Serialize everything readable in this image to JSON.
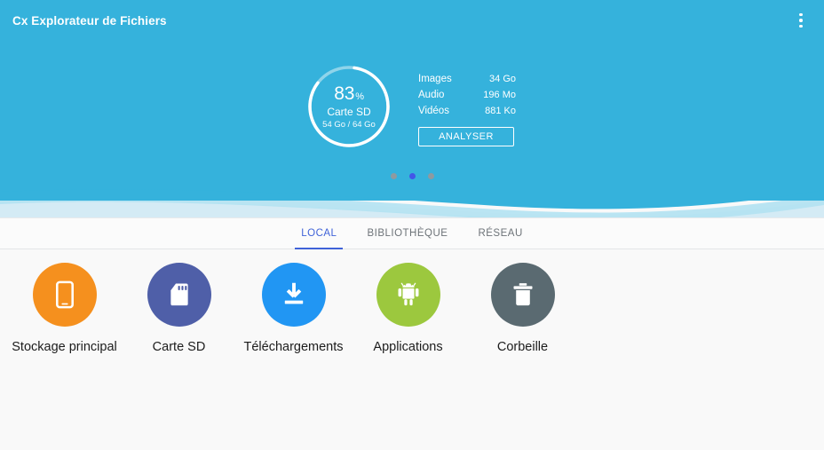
{
  "app": {
    "title": "Cx Explorateur de Fichiers",
    "header_color": "#35b2dc",
    "wave_light_color": "#b3e2f2",
    "wave_pale_color": "#eef4f6",
    "background": "#f9f9f9"
  },
  "appbar": {
    "overflow_icon": "more-vertical-icon"
  },
  "storage": {
    "percent": "83",
    "percent_symbol": "%",
    "label": "Carte SD",
    "detail": "54 Go / 64 Go",
    "used_gb": 54,
    "total_gb": 64,
    "percent_value": 83
  },
  "stats": {
    "rows": [
      {
        "label": "Images",
        "value": "34 Go"
      },
      {
        "label": "Audio",
        "value": "196 Mo"
      },
      {
        "label": "Vidéos",
        "value": "881 Ko"
      }
    ],
    "analyse_label": "ANALYSER"
  },
  "carousel": {
    "dots": [
      {
        "active": false
      },
      {
        "active": true
      },
      {
        "active": false
      }
    ],
    "active_color": "#4356e8",
    "inactive_color": "#8e9aa0"
  },
  "tabs": {
    "active_color": "#3f62d8",
    "items": [
      {
        "label": "LOCAL",
        "active": true
      },
      {
        "label": "BIBLIOTHÈQUE",
        "active": false
      },
      {
        "label": "RÉSEAU",
        "active": false
      }
    ]
  },
  "shortcuts": [
    {
      "label": "Stockage principal",
      "icon": "phone-icon",
      "color": "#f5901e"
    },
    {
      "label": "Carte SD",
      "icon": "sd-card-icon",
      "color": "#4f5fa8"
    },
    {
      "label": "Téléchargements",
      "icon": "download-icon",
      "color": "#2196f3"
    },
    {
      "label": "Applications",
      "icon": "android-icon",
      "color": "#9cc83e"
    },
    {
      "label": "Corbeille",
      "icon": "trash-icon",
      "color": "#5a6a71"
    }
  ]
}
